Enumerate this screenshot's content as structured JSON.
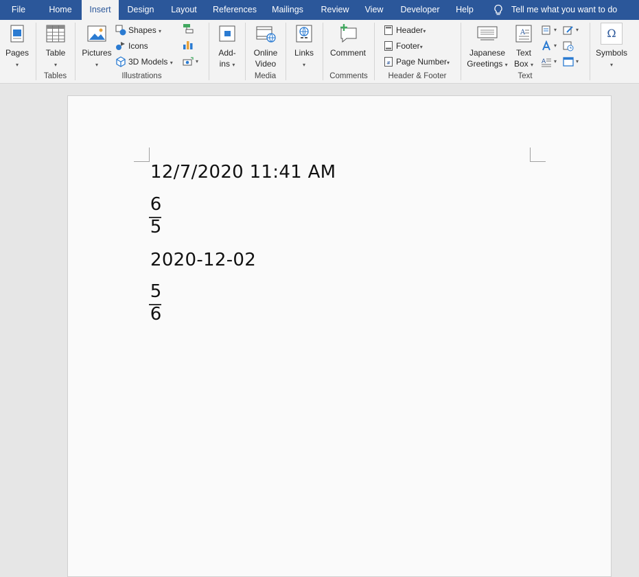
{
  "tabs": [
    {
      "label": "File"
    },
    {
      "label": "Home"
    },
    {
      "label": "Insert",
      "active": true
    },
    {
      "label": "Design"
    },
    {
      "label": "Layout"
    },
    {
      "label": "References"
    },
    {
      "label": "Mailings"
    },
    {
      "label": "Review"
    },
    {
      "label": "View"
    },
    {
      "label": "Developer"
    },
    {
      "label": "Help"
    }
  ],
  "tell_me": "Tell me what you want to do",
  "ribbon": {
    "pages": {
      "label": "Pages"
    },
    "tables": {
      "group": "Tables",
      "table": "Table"
    },
    "illustrations": {
      "group": "Illustrations",
      "pictures": "Pictures",
      "shapes": "Shapes",
      "icons": "Icons",
      "models": "3D Models"
    },
    "addins": {
      "label_line1": "Add-",
      "label_line2": "ins"
    },
    "media": {
      "group": "Media",
      "line1": "Online",
      "line2": "Video"
    },
    "links": {
      "label": "Links"
    },
    "comments": {
      "group": "Comments",
      "comment": "Comment"
    },
    "header_footer": {
      "group": "Header & Footer",
      "header": "Header",
      "footer": "Footer",
      "page_number": "Page Number"
    },
    "text": {
      "group": "Text",
      "japanese_line1": "Japanese",
      "japanese_line2": "Greetings",
      "textbox_line1": "Text",
      "textbox_line2": "Box"
    },
    "symbols": {
      "label": "Symbols",
      "glyph": "Ω"
    }
  },
  "document": {
    "line1": "12/7/2020 11:41 AM",
    "fraction1": {
      "numerator": "6",
      "denominator": "5"
    },
    "line3": "2020-12-02",
    "fraction2": {
      "numerator": "5",
      "denominator": "6"
    }
  },
  "colors": {
    "accent": "#2b579a",
    "ribbon_bg": "#f3f3f3",
    "page_bg": "#fafafa"
  }
}
